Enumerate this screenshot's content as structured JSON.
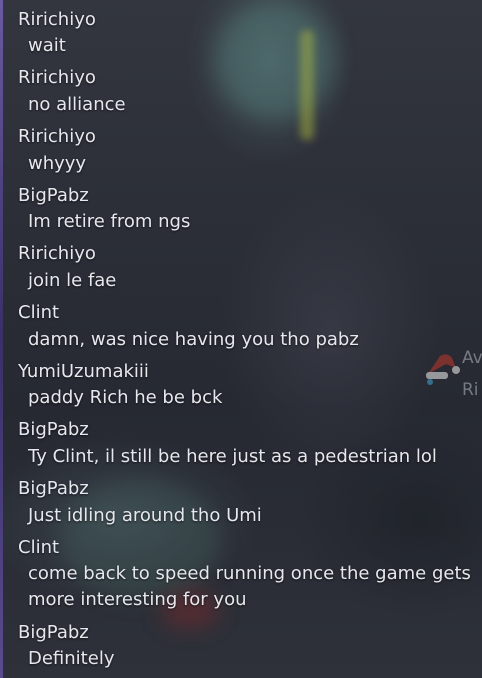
{
  "side_badge": {
    "icon": "santa-hat-icon",
    "line1": "Av",
    "line2": "Ri"
  },
  "chat": {
    "messages": [
      {
        "user": "Ririchiyo",
        "text": "wait"
      },
      {
        "user": "Ririchiyo",
        "text": "no alliance"
      },
      {
        "user": "Ririchiyo",
        "text": "whyyy"
      },
      {
        "user": "BigPabz",
        "text": "Im retire from ngs"
      },
      {
        "user": "Ririchiyo",
        "text": "join le fae"
      },
      {
        "user": "Clint",
        "text": "damn, was nice having you tho pabz"
      },
      {
        "user": "YumiUzumakiii",
        "text": "paddy Rich he be bck"
      },
      {
        "user": "BigPabz",
        "text": "Ty Clint, il still be here just as a pedestrian lol"
      },
      {
        "user": "BigPabz",
        "text": "Just idling around tho Umi"
      },
      {
        "user": "Clint",
        "text": "come back to speed running once the game gets more interesting for you"
      },
      {
        "user": "BigPabz",
        "text": "Definitely"
      }
    ]
  }
}
